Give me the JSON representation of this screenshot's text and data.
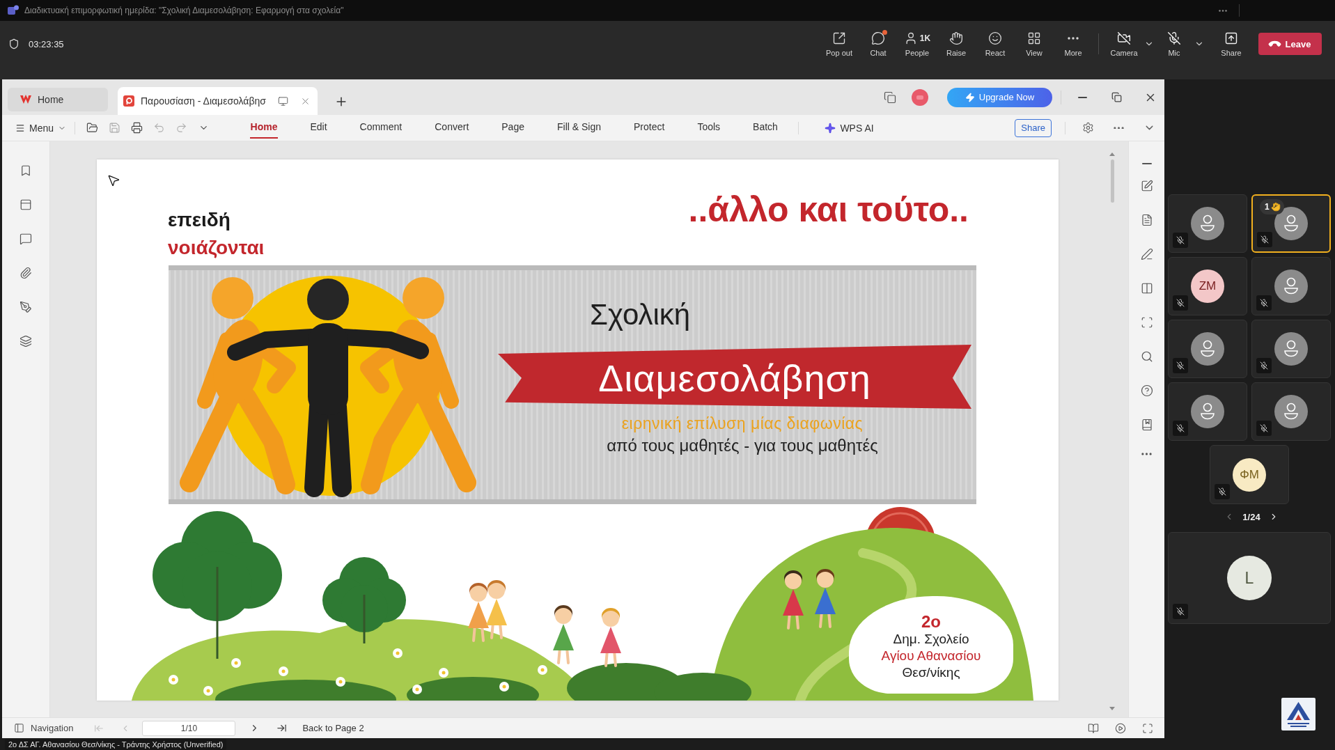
{
  "meeting_title": "Διαδικτυακή επιμορφωτική ημερίδα: \"Σχολική Διαμεσολάβηση: Εφαρμογή στα σχολεία\"",
  "meeting": {
    "timer": "03:23:35",
    "tools": [
      {
        "kind": "popout",
        "label": "Pop out",
        "badge": false
      },
      {
        "kind": "chat",
        "label": "Chat",
        "badge": true
      },
      {
        "kind": "people",
        "label": "People",
        "count": "1K",
        "badge": false
      },
      {
        "kind": "raise",
        "label": "Raise",
        "badge": false
      },
      {
        "kind": "react",
        "label": "React",
        "badge": false
      },
      {
        "kind": "view",
        "label": "View",
        "badge": false
      },
      {
        "kind": "more",
        "label": "More",
        "badge": false
      }
    ],
    "devices": [
      {
        "kind": "camera",
        "label": "Camera",
        "on": false
      },
      {
        "kind": "mic",
        "label": "Mic",
        "on": false
      }
    ],
    "share": "Share",
    "leave": "Leave"
  },
  "app": {
    "tabs": [
      {
        "kind": "home",
        "label": "Home",
        "selected": false
      },
      {
        "kind": "document",
        "label": "Παρουσίαση - Διαμεσολάβησ",
        "selected": true
      }
    ],
    "upgrade": "Upgrade Now",
    "menu": "Menu",
    "ribbon_tabs": [
      {
        "label": "Home",
        "selected": true
      },
      {
        "label": "Edit",
        "selected": false
      },
      {
        "label": "Comment",
        "selected": false
      },
      {
        "label": "Convert",
        "selected": false
      },
      {
        "label": "Page",
        "selected": false
      },
      {
        "label": "Fill & Sign",
        "selected": false
      },
      {
        "label": "Protect",
        "selected": false
      },
      {
        "label": "Tools",
        "selected": false
      },
      {
        "label": "Batch",
        "selected": false
      }
    ],
    "ai": "WPS AI",
    "share": "Share",
    "slide": {
      "side_lines": [
        {
          "text": "επειδή",
          "color": "#1a1a1a"
        },
        {
          "text": "νοιάζονται",
          "color": "#c3262c"
        }
      ],
      "heading": "..άλλο και τούτο..",
      "banner": {
        "title": "Σχολική",
        "ribbon": "Διαμεσολάβηση",
        "subtitle": "ειρηνική επίλυση μίας διαφωνίας",
        "tagline": "από τους μαθητές - για τους μαθητές"
      },
      "school": [
        {
          "kind": "ordinal",
          "text": "2ο",
          "color": "#c3262c"
        },
        {
          "kind": "line",
          "text": "Δημ. Σχολείο",
          "color": "#1f1f1f"
        },
        {
          "kind": "line",
          "text": "Αγίου Αθανασίου",
          "color": "#c3262c"
        },
        {
          "kind": "line",
          "text": "Θεσ/νίκης",
          "color": "#1f1f1f"
        }
      ]
    },
    "status_bar": {
      "navigation": "Navigation",
      "page": "1/10",
      "back_link": "Back to Page 2"
    }
  },
  "speaker_caption": "2ο ΔΣ ΑΓ. Αθανασίου Θεσ/νίκης - Τράντης Χρήστος (Unverified)",
  "participants": {
    "tiles": [
      {
        "kind": "silhouette",
        "muted": true,
        "hand_raised": false
      },
      {
        "kind": "silhouette",
        "muted": true,
        "hand_raised": true,
        "hand_order": "1"
      },
      {
        "kind": "initials",
        "initials": "ZM",
        "color": "#f3c7c8",
        "muted": true,
        "hand_raised": false
      },
      {
        "kind": "silhouette",
        "muted": true,
        "hand_raised": false
      },
      {
        "kind": "silhouette",
        "muted": true,
        "hand_raised": false
      },
      {
        "kind": "silhouette",
        "muted": true,
        "hand_raised": false
      },
      {
        "kind": "silhouette",
        "muted": true,
        "hand_raised": false
      },
      {
        "kind": "silhouette",
        "muted": true,
        "hand_raised": false
      },
      {
        "kind": "initials",
        "initials": "ΦΜ",
        "color": "#f8eac3",
        "muted": true,
        "hand_raised": false
      }
    ],
    "pagination": "1/24",
    "featured_tile": {
      "kind": "initials",
      "initials": "L",
      "color": "#e6e9e1",
      "muted": true,
      "hand_raised": false
    }
  }
}
